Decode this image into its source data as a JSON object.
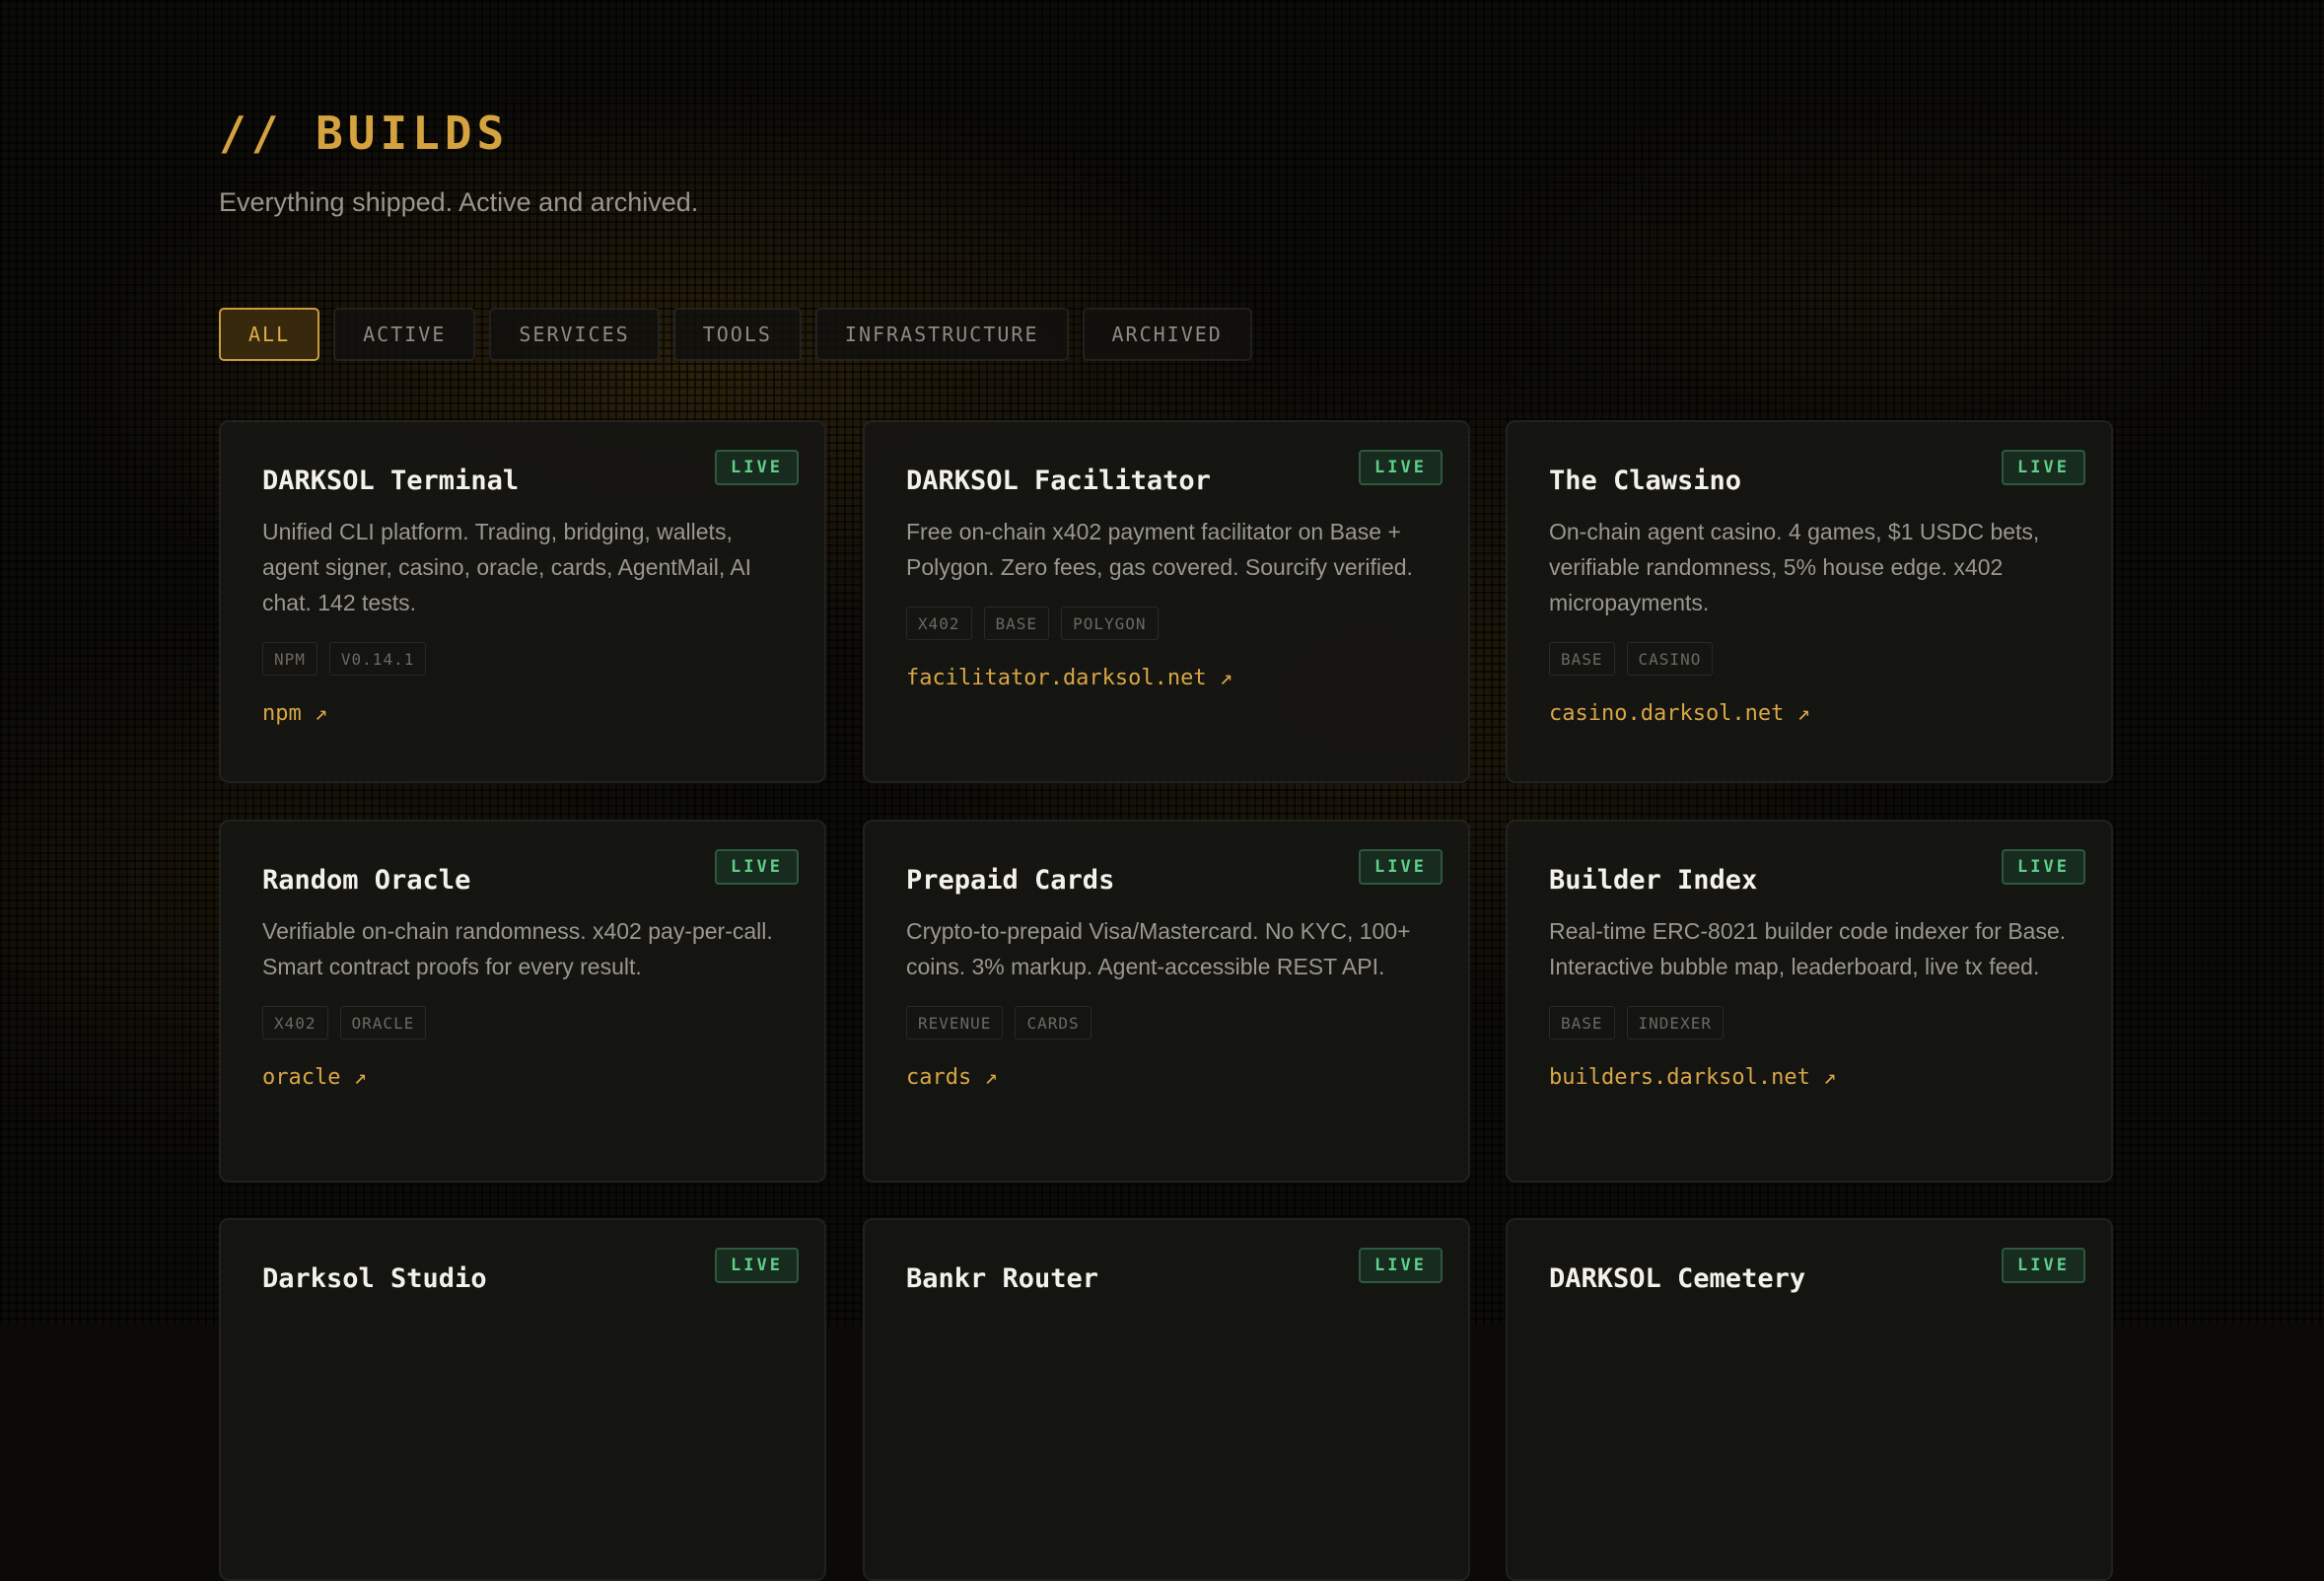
{
  "header": {
    "title": "// BUILDS",
    "subtitle": "Everything shipped. Active and archived."
  },
  "filters": [
    {
      "label": "ALL",
      "active": true
    },
    {
      "label": "ACTIVE",
      "active": false
    },
    {
      "label": "SERVICES",
      "active": false
    },
    {
      "label": "TOOLS",
      "active": false
    },
    {
      "label": "INFRASTRUCTURE",
      "active": false
    },
    {
      "label": "ARCHIVED",
      "active": false
    }
  ],
  "cards": [
    {
      "title": "DARKSOL Terminal",
      "status": "LIVE",
      "description": "Unified CLI platform. Trading, bridging, wallets, agent signer, casino, oracle, cards, AgentMail, AI chat. 142 tests.",
      "tags": [
        "NPM",
        "V0.14.1"
      ],
      "link": "npm ↗"
    },
    {
      "title": "DARKSOL Facilitator",
      "status": "LIVE",
      "description": "Free on-chain x402 payment facilitator on Base + Polygon. Zero fees, gas covered. Sourcify verified.",
      "tags": [
        "X402",
        "BASE",
        "POLYGON"
      ],
      "link": "facilitator.darksol.net ↗"
    },
    {
      "title": "The Clawsino",
      "status": "LIVE",
      "description": "On-chain agent casino. 4 games, $1 USDC bets, verifiable randomness, 5% house edge. x402 micropayments.",
      "tags": [
        "BASE",
        "CASINO"
      ],
      "link": "casino.darksol.net ↗"
    },
    {
      "title": "Random Oracle",
      "status": "LIVE",
      "description": "Verifiable on-chain randomness. x402 pay-per-call. Smart contract proofs for every result.",
      "tags": [
        "X402",
        "ORACLE"
      ],
      "link": "oracle ↗"
    },
    {
      "title": "Prepaid Cards",
      "status": "LIVE",
      "description": "Crypto-to-prepaid Visa/Mastercard. No KYC, 100+ coins. 3% markup. Agent-accessible REST API.",
      "tags": [
        "REVENUE",
        "CARDS"
      ],
      "link": "cards ↗"
    },
    {
      "title": "Builder Index",
      "status": "LIVE",
      "description": "Real-time ERC-8021 builder code indexer for Base. Interactive bubble map, leaderboard, live tx feed.",
      "tags": [
        "BASE",
        "INDEXER"
      ],
      "link": "builders.darksol.net ↗"
    },
    {
      "title": "Darksol Studio",
      "status": "LIVE",
      "description": "",
      "tags": [],
      "link": ""
    },
    {
      "title": "Bankr Router",
      "status": "LIVE",
      "description": "",
      "tags": [],
      "link": ""
    },
    {
      "title": "DARKSOL Cemetery",
      "status": "LIVE",
      "description": "",
      "tags": [],
      "link": ""
    }
  ],
  "colors": {
    "accent": "#d4a23f",
    "live_badge": "#5fcf8a",
    "background": "#0c0b08"
  }
}
